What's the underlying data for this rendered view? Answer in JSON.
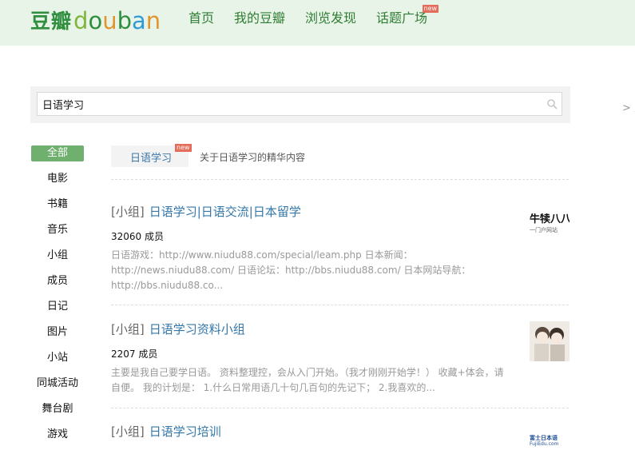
{
  "header": {
    "logo_cn": "豆瓣",
    "logo_en": "douban",
    "nav": [
      {
        "label": "首页"
      },
      {
        "label": "我的豆瓣"
      },
      {
        "label": "浏览发现"
      },
      {
        "label": "话题广场",
        "badge": "new"
      }
    ]
  },
  "search": {
    "value": "日语学习"
  },
  "right_link": "> 豆",
  "sidebar": {
    "items": [
      {
        "label": "全部",
        "active": true
      },
      {
        "label": "电影"
      },
      {
        "label": "书籍"
      },
      {
        "label": "音乐"
      },
      {
        "label": "小组"
      },
      {
        "label": "成员"
      },
      {
        "label": "日记"
      },
      {
        "label": "图片"
      },
      {
        "label": "小站"
      },
      {
        "label": "同城活动"
      },
      {
        "label": "舞台剧"
      },
      {
        "label": "游戏"
      }
    ]
  },
  "subject": {
    "tag": "日语学习",
    "badge": "new",
    "description": "关于日语学习的精华内容"
  },
  "results": [
    {
      "type": "[小组]",
      "name": "日语学习|日语交流|日本留学",
      "members": "32060 成员",
      "abstract": "日语游戏：http://www.niudu88.com/special/leam.php 日本新闻：http://news.niudu88.com/ 日语论坛：http://bbs.niudu88.com/ 日本网站导航：http://bbs.niudu88.co...",
      "thumb_text": "牛犊八八",
      "thumb_sub": "一门户网站"
    },
    {
      "type": "[小组]",
      "name": "日语学习资料小组",
      "members": "2207 成员",
      "abstract": "主要是我自己要学日语。 资料整理控，会从入门开始。（我才刚刚开始学！） 收藏+体会，请自便。 我的计划是： 1.什么日常用语几十句几百句的先记下； 2.我喜欢的...",
      "thumb_text": "",
      "thumb_sub": ""
    },
    {
      "type": "[小组]",
      "name": "日语学习培训",
      "members": "",
      "abstract": "",
      "thumb_text": "富士日本语",
      "thumb_sub": "FujiEdu.com"
    }
  ],
  "colors": {
    "header_bg": "#e9f4e9",
    "nav_green": "#2e7d32",
    "link_blue": "#3377aa",
    "active_green": "#6fb06f"
  }
}
